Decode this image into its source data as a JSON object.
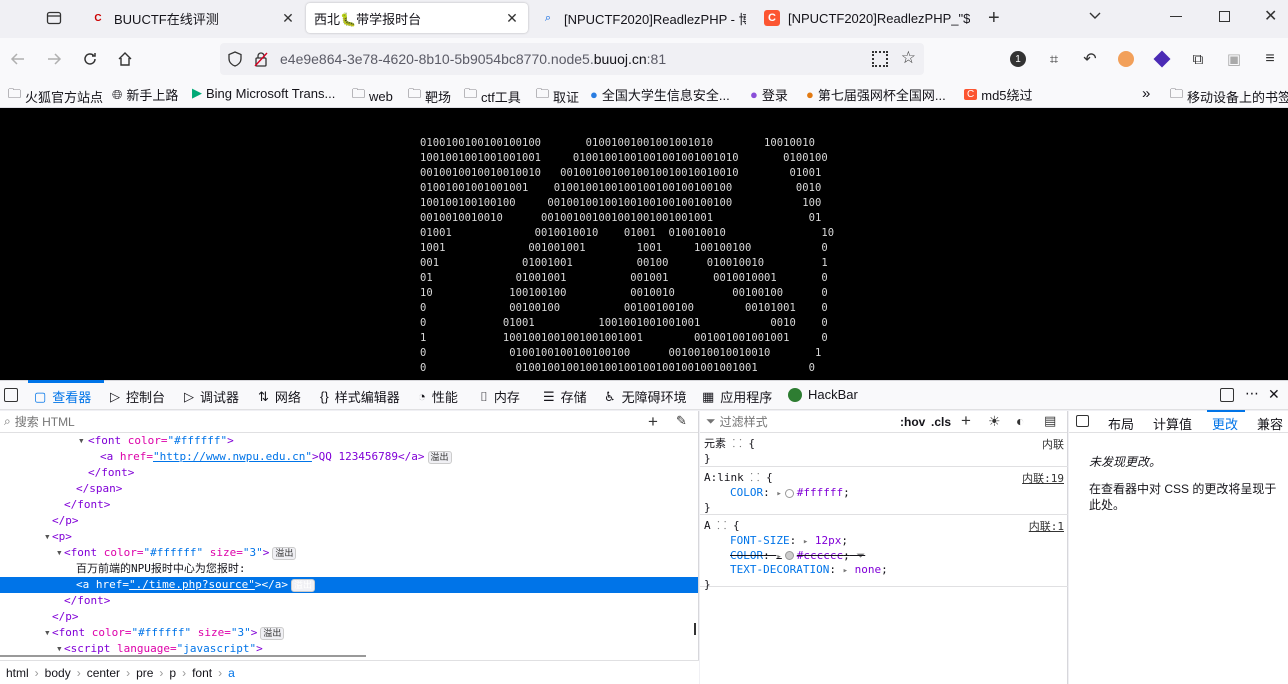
{
  "tabs": [
    {
      "title": "BUUCTF在线评测",
      "favicon": "ctf-icon"
    },
    {
      "title": "西北🐛带学报时台",
      "favicon": "none",
      "active": true
    },
    {
      "title": "[NPUCTF2020]ReadlezPHP - 博",
      "favicon": "search-icon"
    },
    {
      "title": "[NPUCTF2020]ReadlezPHP_\"$",
      "favicon": "csdn-icon"
    }
  ],
  "url": {
    "prefix": "e4e9e864-3e78-4620-8b10-5b9054bc8770.node5.",
    "domain": "buuoj.cn",
    "port": ":81"
  },
  "toolbar_badge": "1",
  "bookmarks": [
    "火狐官方站点",
    "新手上路",
    "Bing Microsoft Trans...",
    "web",
    "靶场",
    "ctf工具",
    "取证",
    "全国大学生信息安全...",
    "登录",
    "第七届强网杯全国网...",
    "md5绕过",
    "移动设备上的书签"
  ],
  "ascii_art": [
    "0100100100100100100       01001001001001001010        10010010",
    "1001001001001001001     01001001001001001001001010       0100100",
    "0010010010010010010   0010010010010010010010010010        01001",
    "01001001001001001    0100100100100100100100100100          0010",
    "100100100100100     00100100100100100100100100100           100",
    "0010010010010      001001001001001001001001001               01",
    "01001             0010010010    01001  010010010               10",
    "1001             001001001        1001     100100100           0",
    "001             01001001          00100      010010010         1",
    "01             01001001          001001       0010010001       0",
    "10            100100100          0010010         00100100      0",
    "0             00100100          00100100100        00101001    0",
    "0            01001          1001001001001001           0010    0",
    "1            1001001001001001001001        001001001001001     0",
    "0             0100100100100100100      0010010010010010       1",
    "0              01001001001001001001001001001001001001        0"
  ],
  "devtools": {
    "tabs": [
      "查看器",
      "控制台",
      "调试器",
      "网络",
      "样式编辑器",
      "性能",
      "内存",
      "存储",
      "无障碍环境",
      "应用程序",
      "HackBar"
    ],
    "search_placeholder": "搜索 HTML",
    "tree": [
      {
        "indent": 0,
        "a": "<font",
        "b": " color=",
        "c": "\"#ffffff\"",
        "d": ">"
      },
      {
        "indent": 1,
        "a": "<a",
        "b": " href=",
        "c": "\"http://www.nwpu.edu.cn\"",
        "d": ">QQ 123456789</a>",
        "badge": "溢出"
      },
      {
        "indent": 0,
        "a": "</font>"
      },
      {
        "indent": -1,
        "a": "</span>"
      },
      {
        "indent": -2,
        "a": "</font>"
      },
      {
        "indent": -3,
        "a": "</p>"
      },
      {
        "indent": -3,
        "a": "<p>"
      },
      {
        "indent": -2,
        "a": "<font",
        "b": " color=",
        "c": "\"#ffffff\"",
        "b2": " size=",
        "c2": "\"3\"",
        "d": ">",
        "badge": "溢出"
      },
      {
        "indent": -1,
        "text": "百万前端的NPU报时中心为您报时:"
      },
      {
        "indent": -1,
        "a": "<a",
        "b": " href=",
        "c": "\"./time.php?source\"",
        "d": "></a>",
        "badge": "溢出",
        "selected": true
      },
      {
        "indent": -2,
        "a": "</font>"
      },
      {
        "indent": -3,
        "a": "</p>"
      },
      {
        "indent": -3,
        "a": "<font",
        "b": " color=",
        "c": "\"#ffffff\"",
        "b2": " size=",
        "c2": "\"3\"",
        "d": ">",
        "badge": "溢出"
      },
      {
        "indent": -2,
        "a": "<script",
        "b": " language=",
        "c": "\"javascript\"",
        "d": ">"
      }
    ],
    "breadcrumb": [
      "html",
      "body",
      "center",
      "pre",
      "p",
      "font",
      "a"
    ],
    "rules_filter": "过滤样式",
    "hov": ":hov",
    "cls": ".cls",
    "rules": [
      {
        "selector": "元素",
        "brace": "{",
        "close": "}",
        "source": "内联",
        "props": []
      },
      {
        "selector": "A:link",
        "brace": "{",
        "close": "}",
        "source": "内联:19",
        "props": [
          {
            "name": "COLOR",
            "value": "#ffffff",
            "swatch": "#ffffff"
          }
        ]
      },
      {
        "selector": "A",
        "brace": "{",
        "close": "}",
        "source": "内联:1",
        "props": [
          {
            "name": "FONT-SIZE",
            "value": "12px"
          },
          {
            "name": "COLOR",
            "value": "#cccccc",
            "swatch": "#cccccc",
            "struck": true
          },
          {
            "name": "TEXT-DECORATION",
            "value": "none"
          }
        ]
      }
    ],
    "right_tabs": [
      "布局",
      "计算值",
      "更改",
      "兼容"
    ],
    "changes_empty": "未发现更改。",
    "changes_hint": "在查看器中对 CSS 的更改将呈现于此处。"
  },
  "colors": {
    "accent": "#0074e8",
    "selection": "#0074e8"
  }
}
